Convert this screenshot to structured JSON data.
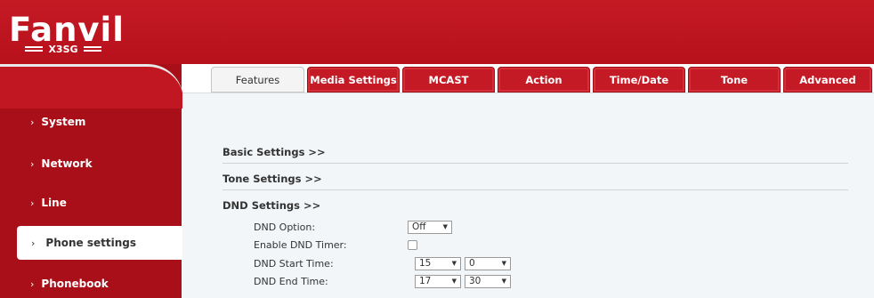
{
  "brand": {
    "logo_text": "Fanvil",
    "model": "X3SG"
  },
  "sidebar": {
    "items": [
      {
        "label": "System"
      },
      {
        "label": "Network"
      },
      {
        "label": "Line"
      },
      {
        "label": "Phone settings"
      },
      {
        "label": "Phonebook"
      }
    ],
    "active_index": 3
  },
  "tabs": [
    {
      "label": "Features"
    },
    {
      "label": "Media Settings"
    },
    {
      "label": "MCAST"
    },
    {
      "label": "Action"
    },
    {
      "label": "Time/Date"
    },
    {
      "label": "Tone"
    },
    {
      "label": "Advanced"
    }
  ],
  "main": {
    "sections": {
      "basic": "Basic Settings >>",
      "tone": "Tone Settings >>",
      "dnd": "DND Settings >>"
    },
    "dnd": {
      "option_label": "DND Option:",
      "option_value": "Off",
      "timer_label": "Enable DND Timer:",
      "timer_checked": false,
      "start_label": "DND Start Time:",
      "start_hour": "15",
      "start_minute": "0",
      "end_label": "DND End Time:",
      "end_hour": "17",
      "end_minute": "30"
    }
  },
  "colors": {
    "brand_red": "#c41a25",
    "sidebar_red": "#a90f19",
    "content_bg": "#f3f6f9"
  }
}
